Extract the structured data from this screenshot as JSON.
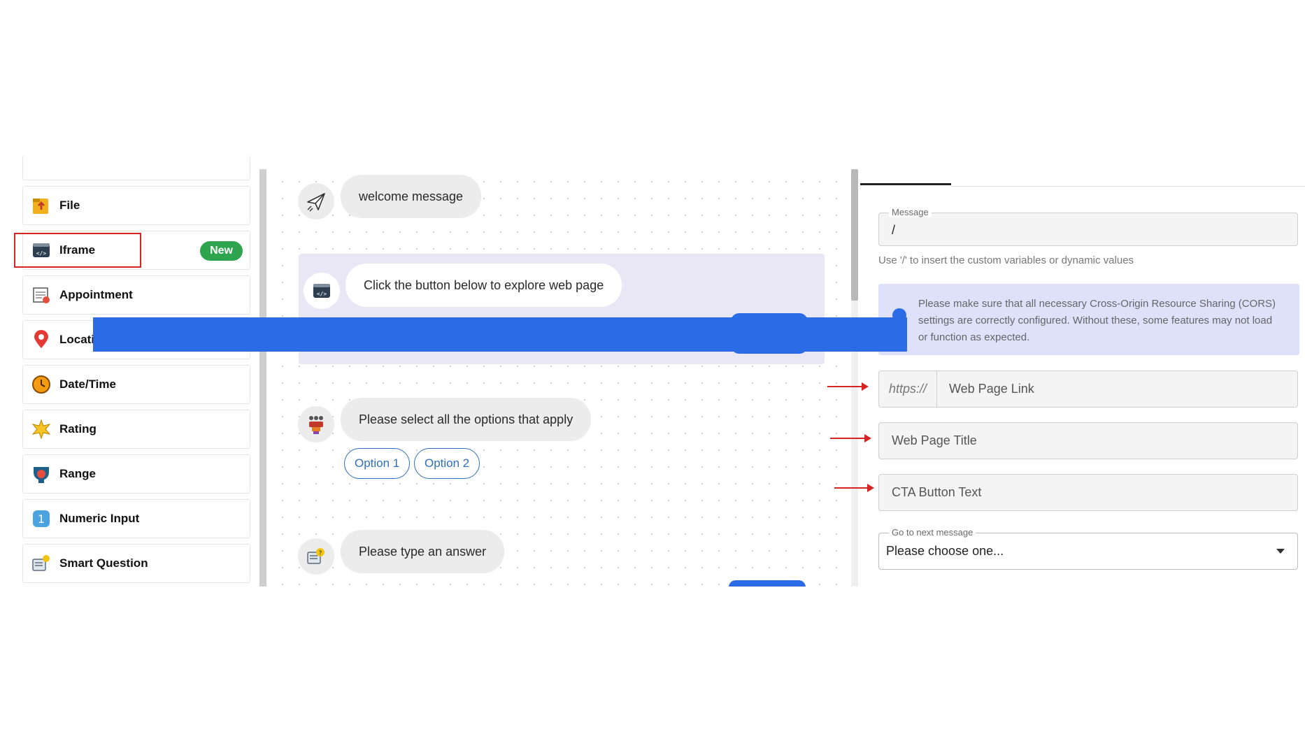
{
  "palette": {
    "items": [
      {
        "label": "File",
        "icon": "file-upload-icon"
      },
      {
        "label": "Iframe",
        "icon": "code-window-icon",
        "badge": "New"
      },
      {
        "label": "Appointment",
        "icon": "calendar-icon"
      },
      {
        "label": "Locatio",
        "icon": "location-pin-icon"
      },
      {
        "label": "Date/Time",
        "icon": "clock-icon"
      },
      {
        "label": "Rating",
        "icon": "star-burst-icon"
      },
      {
        "label": "Range",
        "icon": "range-icon"
      },
      {
        "label": "Numeric Input",
        "icon": "number-one-icon"
      },
      {
        "label": "Smart Question",
        "icon": "smart-question-icon"
      }
    ]
  },
  "canvas": {
    "welcome": "welcome message",
    "iframe_prompt": "Click the button below to explore web page",
    "select_prompt": "Please select all the options that apply",
    "option1": "Option 1",
    "option2": "Option 2",
    "type_prompt": "Please type an answer"
  },
  "panel": {
    "message_label": "Message",
    "message_value": "/",
    "message_hint": "Use '/' to insert the custom variables or dynamic values",
    "cors_notice": "Please make sure that all necessary Cross-Origin Resource Sharing (CORS) settings are correctly configured. Without these, some features may not load or function as expected.",
    "url_prefix": "https://",
    "link_placeholder": "Web Page Link",
    "title_placeholder": "Web Page Title",
    "cta_placeholder": "CTA Button Text",
    "next_label": "Go to next message",
    "next_value": "Please choose one..."
  },
  "colors": {
    "accent_blue": "#2b6be6",
    "new_badge": "#2ea44f",
    "highlight_red": "#d62424",
    "iframe_node_bg": "#e9e6f6",
    "cors_bg": "#dde1fa"
  }
}
